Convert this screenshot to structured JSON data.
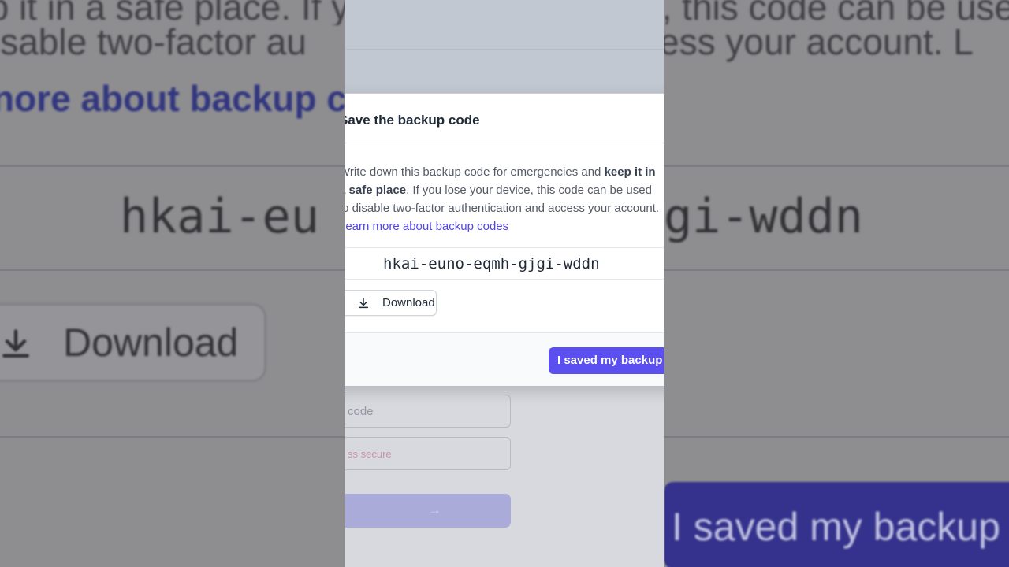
{
  "modal": {
    "title": "Save the backup code",
    "description_part1": "Write down this backup code for emergencies and ",
    "description_bold1": "keep it in a safe place",
    "description_part2": ". If you lose your device, this code can be used to disable two-factor authentication and access your account.",
    "learn_more_link": "Learn more about backup codes",
    "backup_code": "hkai-euno-eqmh-gjgi-wddn",
    "download_label": "Download",
    "confirm_label": "I saved my backup"
  },
  "underlying_form": {
    "code_placeholder": "code",
    "secure_hint": "ss secure",
    "submit_arrow": "→"
  },
  "background_zoom": {
    "line1": "ep it in a safe place. If you lose your device, this code can be used to",
    "line2_left": "isable two-factor au",
    "line2_right": "ccess your account. L",
    "line3": "nore about backup c",
    "code_left": "hkai-eu",
    "code_right": "gi-wddn",
    "download_label": "Download",
    "confirm_label": "I saved my backup"
  },
  "colors": {
    "accent": "#5b50ef",
    "link": "#4f46e5",
    "text": "#1f2937"
  }
}
